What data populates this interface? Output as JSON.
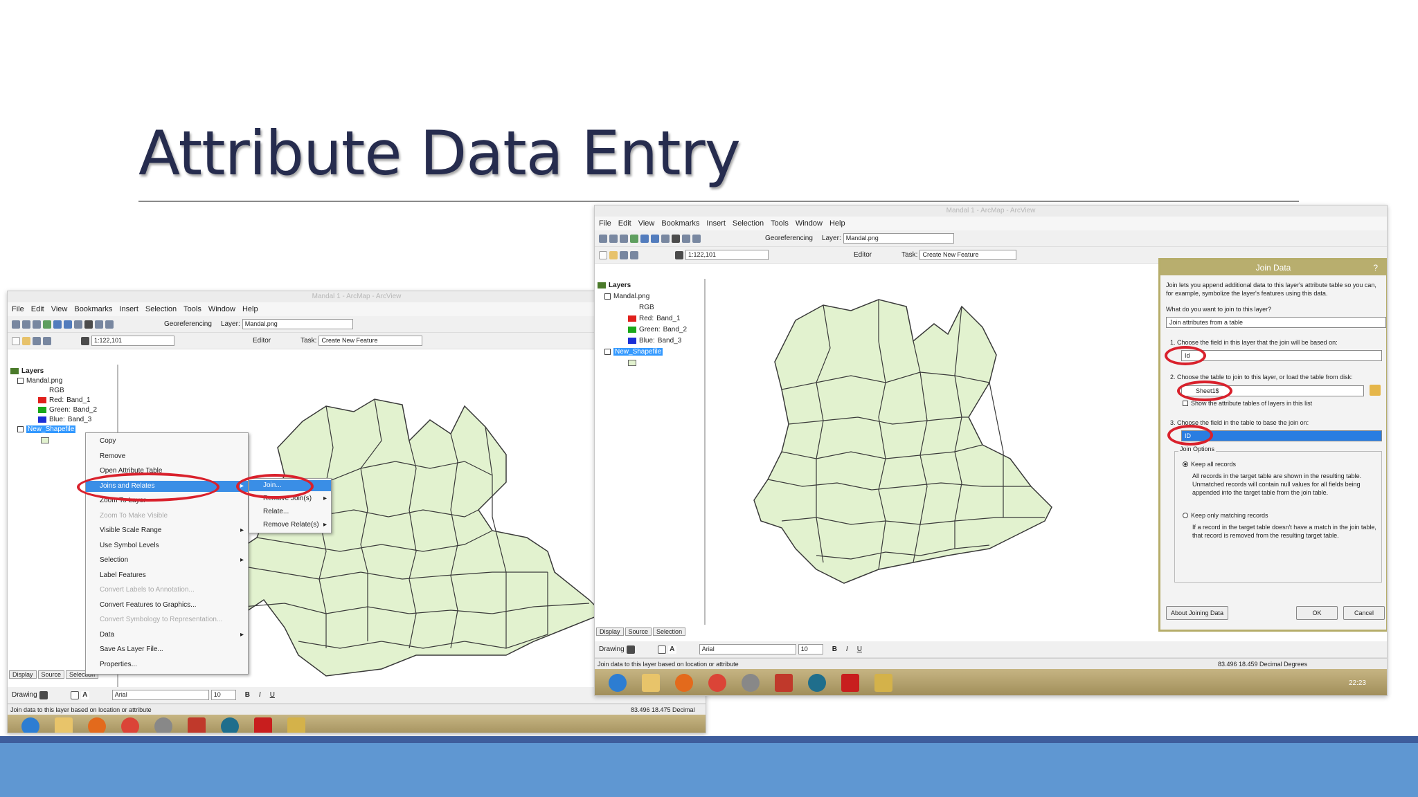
{
  "slide": {
    "title": "Attribute Data Entry"
  },
  "app_window": {
    "title": "Mandal 1 - ArcMap - ArcView",
    "menu": [
      "File",
      "Edit",
      "View",
      "Bookmarks",
      "Insert",
      "Selection",
      "Tools",
      "Window",
      "Help"
    ],
    "georeferencing_label": "Georeferencing",
    "layer_label": "Layer:",
    "layer_value": "Mandal.png",
    "scale_value": "1:122,101",
    "editor_label": "Editor",
    "task_label": "Task:",
    "task_value": "Create New Feature",
    "drawing_label": "Drawing",
    "font_value": "Arial",
    "font_size": "10",
    "status_left": "Join data to this layer based on location or attribute"
  },
  "toc": {
    "root": "Layers",
    "raster": "Mandal.png",
    "rgb": "RGB",
    "bands": [
      {
        "label": "Red:",
        "band": "Band_1",
        "color": "#e0201c"
      },
      {
        "label": "Green:",
        "band": "Band_2",
        "color": "#1aa81a"
      },
      {
        "label": "Blue:",
        "band": "Band_3",
        "color": "#1c2fd6"
      }
    ],
    "shapefile": "New_Shapefile",
    "tabs": [
      "Display",
      "Source",
      "Selection"
    ]
  },
  "left_shot": {
    "status_right": "83.496  18.475 Decimal"
  },
  "right_shot": {
    "status_right": "83.496  18.459 Decimal Degrees",
    "clock": "22:23"
  },
  "context_menu": {
    "items": [
      {
        "label": "Copy",
        "disabled": false
      },
      {
        "label": "Remove",
        "disabled": false
      },
      {
        "label": "Open Attribute Table",
        "disabled": false
      },
      {
        "label": "Joins and Relates",
        "disabled": false,
        "highlighted": true,
        "submenu": true
      },
      {
        "label": "Zoom To Layer",
        "disabled": false
      },
      {
        "label": "Zoom To Make Visible",
        "disabled": true
      },
      {
        "label": "Visible Scale Range",
        "disabled": false,
        "submenu": true
      },
      {
        "label": "Use Symbol Levels",
        "disabled": false
      },
      {
        "label": "Selection",
        "disabled": false,
        "submenu": true
      },
      {
        "label": "Label Features",
        "disabled": false
      },
      {
        "label": "Convert Labels to Annotation...",
        "disabled": true
      },
      {
        "label": "Convert Features to Graphics...",
        "disabled": false
      },
      {
        "label": "Convert Symbology to Representation...",
        "disabled": true
      },
      {
        "label": "Data",
        "disabled": false,
        "submenu": true
      },
      {
        "label": "Save As Layer File...",
        "disabled": false
      },
      {
        "label": "Properties...",
        "disabled": false
      }
    ]
  },
  "submenu": {
    "items": [
      {
        "label": "Join...",
        "highlighted": true
      },
      {
        "label": "Remove Join(s)",
        "submenu": true
      },
      {
        "label": "Relate...",
        "submenu": false
      },
      {
        "label": "Remove Relate(s)",
        "submenu": true
      }
    ]
  },
  "join_dialog": {
    "title": "Join Data",
    "help": "?",
    "intro": "Join lets you append additional data to this layer's attribute table so you can, for example, symbolize the layer's features using this data.",
    "question": "What do you want to join to this layer?",
    "join_type": "Join attributes from a table",
    "step1": "1.  Choose the field in this layer that the join will be based on:",
    "step1_value": "Id",
    "step2": "2.  Choose the table to join to this layer, or load the table from disk:",
    "step2_value": "Sheet1$",
    "show_attr": "Show the attribute tables of layers in this list",
    "step3": "3.  Choose the field in the table to base the join on:",
    "step3_value": "ID",
    "options_label": "Join Options",
    "opt1_title": "Keep all records",
    "opt1_desc": "All records in the target table are shown in the resulting table. Unmatched records will contain null values for all fields being appended into the target table from the join table.",
    "opt2_title": "Keep only matching records",
    "opt2_desc": "If a record in the target table doesn't have a match in the join table, that record is removed from the resulting target table.",
    "about": "About Joining Data",
    "ok": "OK",
    "cancel": "Cancel"
  },
  "colors": {
    "map_fill": "#e2f2cf",
    "map_stroke": "#3a3a3a",
    "highlight_circle": "#d9212c",
    "footer": "#5f97d2"
  }
}
